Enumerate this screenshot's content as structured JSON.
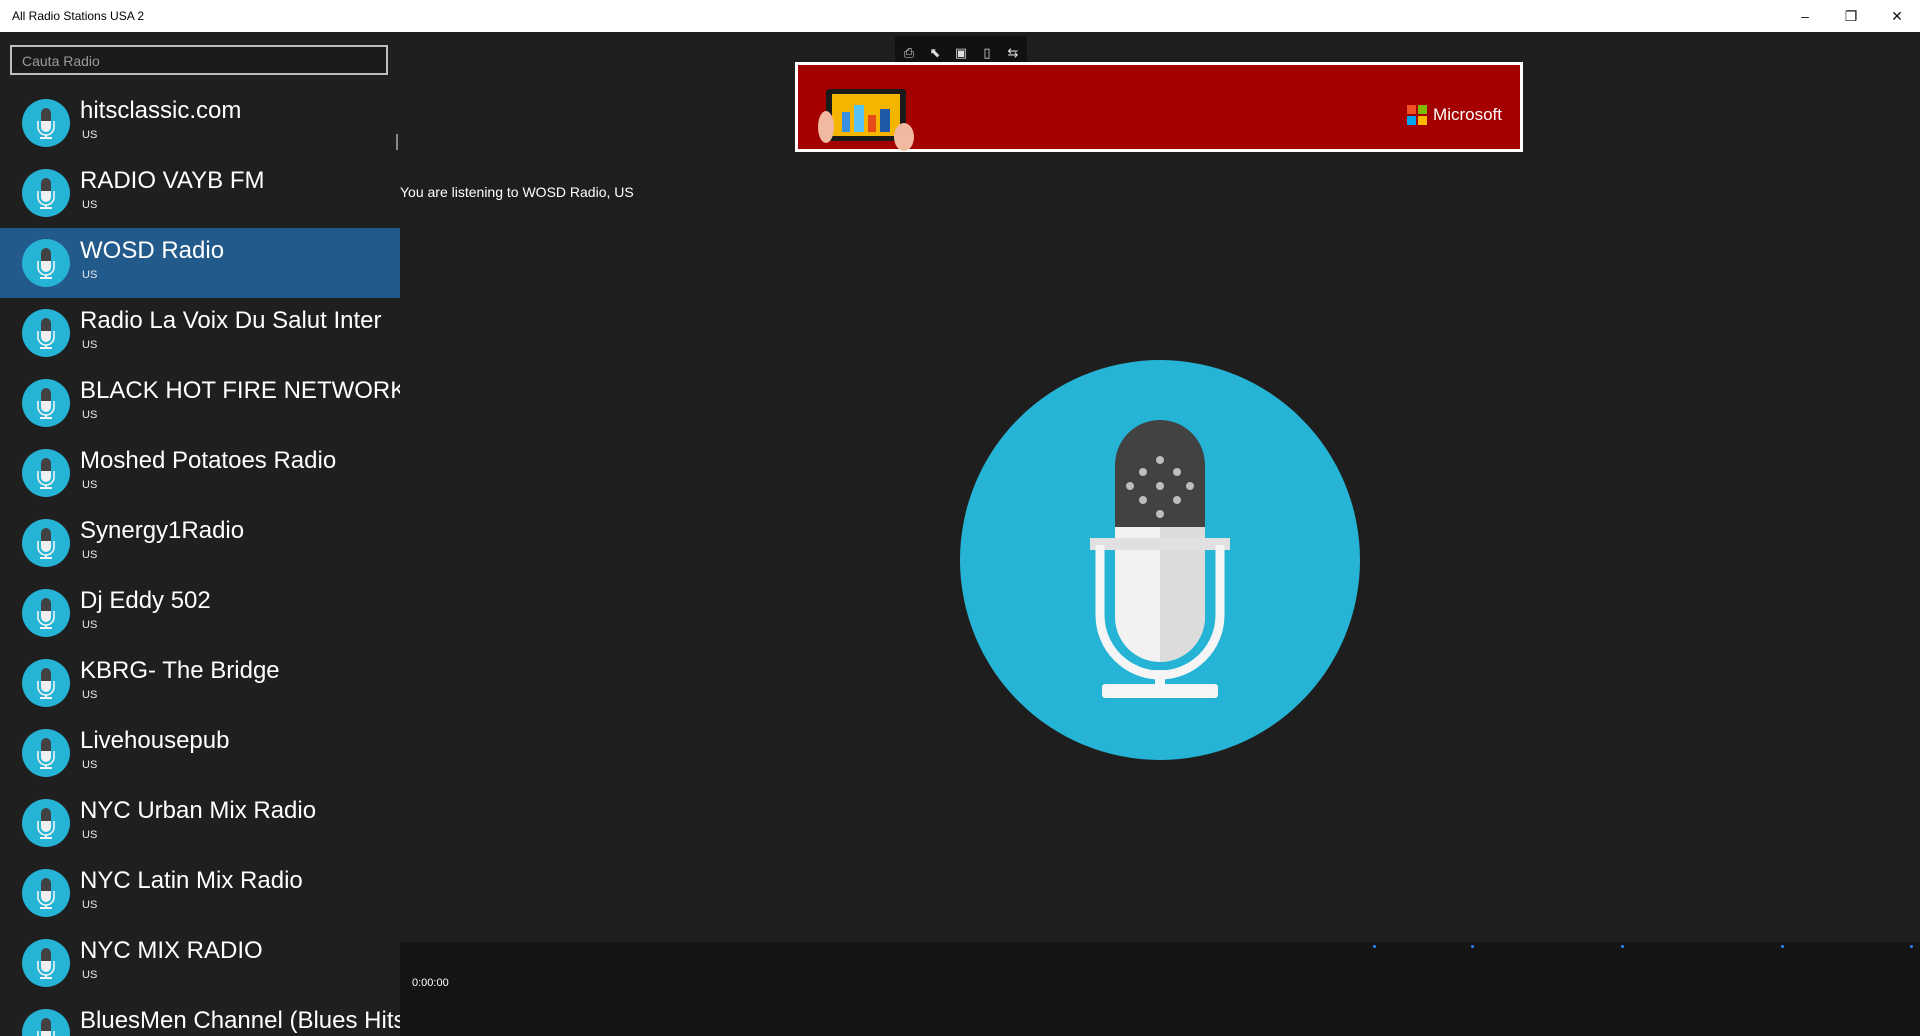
{
  "window": {
    "title": "All Radio Stations USA 2",
    "controls": {
      "minimize": "–",
      "maximize": "❐",
      "close": "✕"
    }
  },
  "search": {
    "placeholder": "Cauta Radio"
  },
  "stations": [
    {
      "name": "hitsclassic.com",
      "country": "US"
    },
    {
      "name": "RADIO VAYB FM",
      "country": "US"
    },
    {
      "name": "WOSD Radio",
      "country": "US",
      "selected": true
    },
    {
      "name": "Radio La Voix Du Salut Inter",
      "country": "US"
    },
    {
      "name": "BLACK HOT FIRE NETWORK",
      "country": "US"
    },
    {
      "name": "Moshed Potatoes Radio",
      "country": "US"
    },
    {
      "name": "Synergy1Radio",
      "country": "US"
    },
    {
      "name": "Dj Eddy 502",
      "country": "US"
    },
    {
      "name": "KBRG- The Bridge",
      "country": "US"
    },
    {
      "name": "Livehousepub",
      "country": "US"
    },
    {
      "name": "NYC Urban Mix Radio",
      "country": "US"
    },
    {
      "name": "NYC Latin Mix Radio",
      "country": "US"
    },
    {
      "name": "NYC MIX RADIO",
      "country": "US"
    },
    {
      "name": "BluesMen Channel (Blues Hits",
      "country": ""
    }
  ],
  "ad": {
    "brand": "Microsoft",
    "toolbar_icons": [
      "ad-info-icon",
      "pointer-icon",
      "expand-icon",
      "device-icon",
      "share-icon"
    ],
    "colors": {
      "background": "#a40000"
    }
  },
  "now_playing": {
    "text": "You are listening to WOSD Radio, US"
  },
  "player": {
    "time": "0:00:00"
  },
  "colors": {
    "accent": "#25b3d6",
    "selected": "#235a8c",
    "background": "#1e1e1e"
  }
}
